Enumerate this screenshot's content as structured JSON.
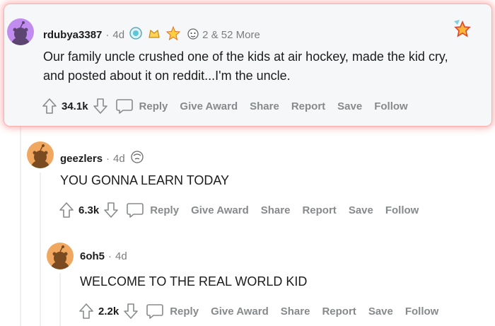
{
  "comments": [
    {
      "username": "rdubya3387",
      "age": "4d",
      "more_awards": "2 & 52 More",
      "body_lines": [
        "Our family uncle crushed one of the kids at air hockey, made the kid cry,",
        "and posted about it on reddit...I'm the uncle."
      ],
      "score": "34.1k",
      "actions": {
        "reply": "Reply",
        "give_award": "Give Award",
        "share": "Share",
        "report": "Report",
        "save": "Save",
        "follow": "Follow"
      }
    },
    {
      "username": "geezlers",
      "age": "4d",
      "body_lines": [
        "YOU GONNA LEARN TODAY"
      ],
      "score": "6.3k",
      "actions": {
        "reply": "Reply",
        "give_award": "Give Award",
        "share": "Share",
        "report": "Report",
        "save": "Save",
        "follow": "Follow"
      }
    },
    {
      "username": "6oh5",
      "age": "4d",
      "body_lines": [
        "WELCOME TO THE REAL WORLD KID"
      ],
      "score": "2.2k",
      "actions": {
        "reply": "Reply",
        "give_award": "Give Award",
        "share": "Share",
        "report": "Report",
        "save": "Save",
        "follow": "Follow"
      }
    }
  ],
  "colors": {
    "highlight_glow": "#ff5050",
    "avatar_purple": "#c18cf0",
    "avatar_orange": "#f0a860",
    "meta_gray": "#7c7c7c",
    "action_gray": "#878a8c"
  },
  "icons": [
    "upvote-icon",
    "downvote-icon",
    "reply-icon",
    "award-icon",
    "snoo-avatar-icon"
  ]
}
